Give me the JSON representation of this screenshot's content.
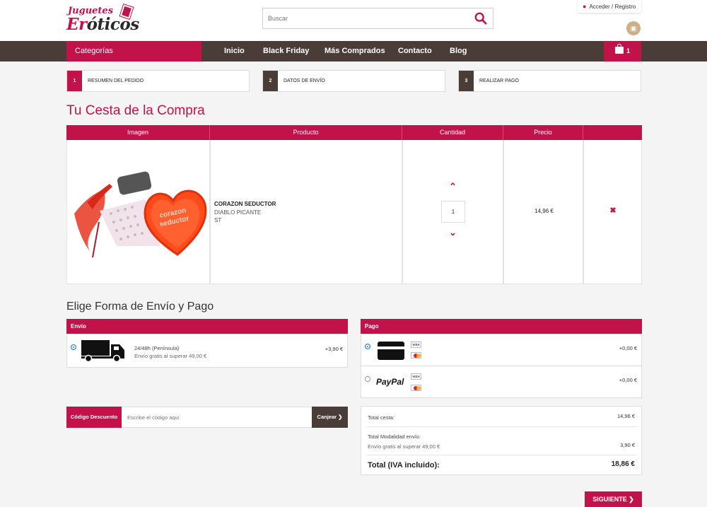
{
  "header": {
    "logo_line1": "Juguetes",
    "logo_line2a": "Er",
    "logo_line2b": "óticos",
    "search_placeholder": "Buscar",
    "login_label": "Acceder / Registro",
    "social_icon": "instagram-icon"
  },
  "nav": {
    "categories": "Categorías",
    "links": [
      "Inicio",
      "Black Friday",
      "Más Comprados",
      "Contacto",
      "Blog"
    ],
    "cart_count": "1"
  },
  "steps": [
    {
      "num": "1",
      "label": "RESUMEN DEL PEDIDO"
    },
    {
      "num": "2",
      "label": "DATOS DE ENVÍO"
    },
    {
      "num": "3",
      "label": "REALIZAR PAGO"
    }
  ],
  "cart": {
    "title": "Tu Cesta de la Compra",
    "headers": [
      "Imagen",
      "Producto",
      "Cantidad",
      "Precio",
      ""
    ],
    "item": {
      "name": "CORAZON SEDUCTOR",
      "brand": "DIABLO PICANTE",
      "sku": "ST",
      "quantity": "1",
      "price": "14,96 €",
      "image_text_1": "corazon",
      "image_text_2": "seductor"
    }
  },
  "shipping_payment": {
    "title": "Elige Forma de Envío y Pago",
    "shipping_header": "Envío",
    "shipping_name": "24/48h (Península)",
    "shipping_note": "Envío gratis al superar 49,00 €",
    "shipping_price": "+3,90 €",
    "payment_header": "Pago",
    "card_price": "+0,00 €",
    "paypal_label": "PayPal",
    "paypal_price": "+0,00 €",
    "visa_label": "VISA"
  },
  "coupon": {
    "label": "Código Descuento",
    "placeholder": "Escribe el código aquí",
    "button": "Canjear"
  },
  "totals": {
    "cart_label": "Total cesta:",
    "cart_value": "14,96 €",
    "shipping_label": "Total Modalidad envío:",
    "shipping_note": "Envío gratis al superar 49,00 €",
    "shipping_value": "3,90 €",
    "grand_label": "Total (IVA incluido):",
    "grand_value": "18,86 €"
  },
  "next_button": "SIGUIENTE",
  "colors": {
    "accent": "#c2124a",
    "dark": "#4a3d38",
    "background": "#f4f4f4"
  }
}
